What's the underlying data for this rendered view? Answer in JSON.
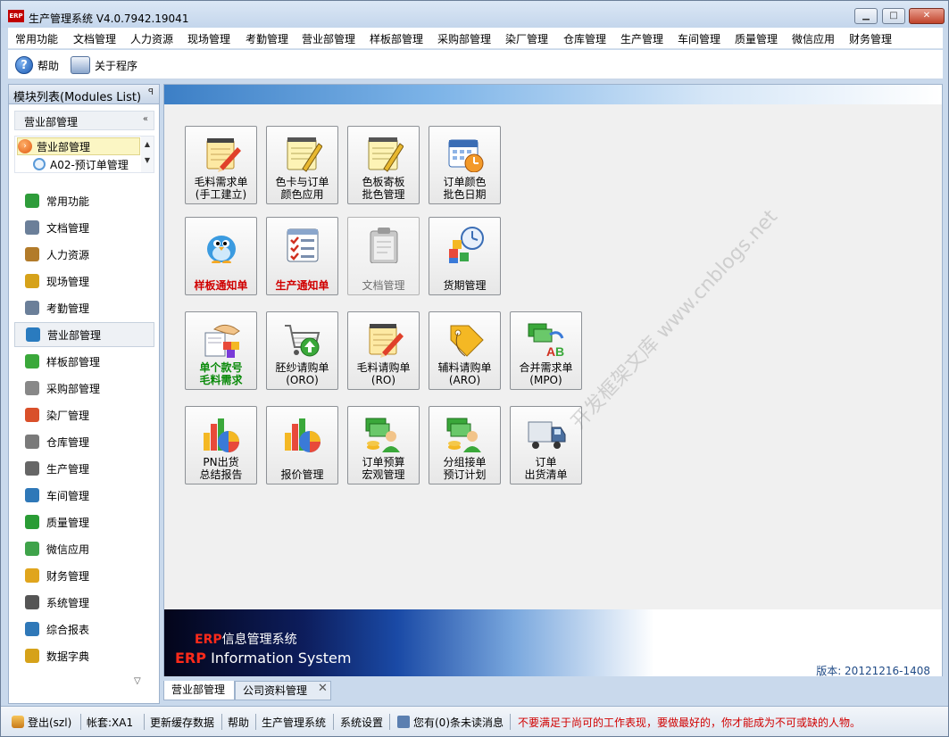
{
  "window": {
    "title": "生产管理系统 V4.0.7942.19041",
    "logo_text": "ERP",
    "controls": {
      "minimize": "▁",
      "maximize": "□",
      "close": "✕"
    }
  },
  "menubar": {
    "items": [
      "常用功能",
      "文档管理",
      "人力资源",
      "现场管理",
      "考勤管理",
      "营业部管理",
      "样板部管理",
      "采购部管理",
      "染厂管理",
      "仓库管理",
      "生产管理",
      "车间管理",
      "质量管理",
      "微信应用",
      "财务管理"
    ]
  },
  "toolbar": {
    "help_label": "帮助",
    "help_icon": "?",
    "about_label": "关于程序"
  },
  "sidebar": {
    "title": "模块列表(Modules List)",
    "pin_icon": "ꟼ",
    "group": {
      "title": "营业部管理",
      "collapse_icon": "«"
    },
    "tree": {
      "selected": "营业部管理",
      "child": "A02-预订单管理",
      "scroll_up": "▲",
      "scroll_down": "▼"
    },
    "modules": [
      {
        "label": "常用功能",
        "color": "#2e9c3a"
      },
      {
        "label": "文档管理",
        "color": "#6b7f99"
      },
      {
        "label": "人力资源",
        "color": "#b27b2a"
      },
      {
        "label": "现场管理",
        "color": "#d6a21a"
      },
      {
        "label": "考勤管理",
        "color": "#6b7f99"
      },
      {
        "label": "营业部管理",
        "color": "#2a7bbf"
      },
      {
        "label": "样板部管理",
        "color": "#3aa83a"
      },
      {
        "label": "采购部管理",
        "color": "#888888"
      },
      {
        "label": "染厂管理",
        "color": "#d9502a"
      },
      {
        "label": "仓库管理",
        "color": "#7a7a7a"
      },
      {
        "label": "生产管理",
        "color": "#666666"
      },
      {
        "label": "车间管理",
        "color": "#2f78b8"
      },
      {
        "label": "质量管理",
        "color": "#2a9c35"
      },
      {
        "label": "微信应用",
        "color": "#3fa34a"
      },
      {
        "label": "财务管理",
        "color": "#e0a51d"
      },
      {
        "label": "系统管理",
        "color": "#555555"
      },
      {
        "label": "综合报表",
        "color": "#2f78b8"
      },
      {
        "label": "数据字典",
        "color": "#d6a21a"
      }
    ],
    "active_index": 5,
    "more_arrow": "▽"
  },
  "tiles": [
    {
      "label": "毛料需求单\n(手工建立)",
      "icon": "notepad-pencil-icon",
      "style": "normal"
    },
    {
      "label": "色卡与订单\n颜色应用",
      "icon": "notepad-pen-icon",
      "style": "normal"
    },
    {
      "label": "色板寄板\n批色管理",
      "icon": "notepad-pen-icon",
      "style": "normal"
    },
    {
      "label": "订单颜色\n批色日期",
      "icon": "calendar-clock-icon",
      "style": "normal"
    },
    {
      "label": "样板通知单",
      "icon": "blue-bird-icon",
      "style": "red"
    },
    {
      "label": "生产通知单",
      "icon": "checklist-icon",
      "style": "red"
    },
    {
      "label": "文档管理",
      "icon": "clipboard-icon",
      "style": "gray"
    },
    {
      "label": "货期管理",
      "icon": "cubes-clock-icon",
      "style": "normal"
    },
    {
      "label": "单个款号\n毛料需求",
      "icon": "hand-blocks-icon",
      "style": "green"
    },
    {
      "label": "胚纱请购单\n(ORO)",
      "icon": "cart-upload-icon",
      "style": "normal"
    },
    {
      "label": "毛料请购单\n(RO)",
      "icon": "notepad-pencil-icon",
      "style": "normal"
    },
    {
      "label": "辅料请购单\n(ARO)",
      "icon": "tag-icon",
      "style": "normal"
    },
    {
      "label": "合并需求单\n(MPO)",
      "icon": "merge-ab-icon",
      "style": "normal"
    },
    {
      "label": "PN出货\n总结报告",
      "icon": "bar-pie-chart-icon",
      "style": "normal"
    },
    {
      "label": "报价管理",
      "icon": "bar-pie-chart-icon",
      "style": "normal"
    },
    {
      "label": "订单预算\n宏观管理",
      "icon": "orders-person-icon",
      "style": "normal"
    },
    {
      "label": "分组接单\n预订计划",
      "icon": "orders-person-icon",
      "style": "normal"
    },
    {
      "label": "订单\n出货清单",
      "icon": "truck-icon",
      "style": "normal"
    }
  ],
  "banner": {
    "erp_word": "ERP",
    "line1_rest": "信息管理系统",
    "line2_rest": " Information System",
    "version": "版本: 20121216-1408"
  },
  "watermark": "开发框架文库 www.cnblogs.net",
  "tabs": [
    {
      "label": "营业部管理"
    },
    {
      "label": "公司资料管理"
    }
  ],
  "tab_close": "✕",
  "status": {
    "logout": "登出(szl)",
    "account": "帐套:XA1",
    "refresh": "更新缓存数据",
    "help": "帮助",
    "system": "生产管理系统",
    "settings": "系统设置",
    "messages": "您有(0)条未读消息",
    "notice": "不要满足于尚可的工作表现，要做最好的，你才能成为不可或缺的人物。"
  }
}
